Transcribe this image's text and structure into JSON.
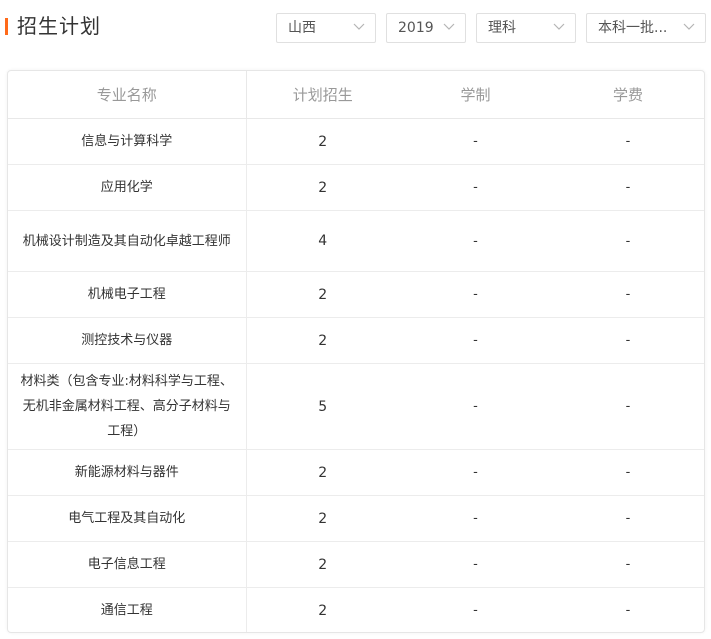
{
  "header": {
    "title": "招生计划"
  },
  "filters": {
    "province": "山西",
    "year": "2019",
    "subject": "理科",
    "batch": "本科一批..."
  },
  "table": {
    "columns": [
      "专业名称",
      "计划招生",
      "学制",
      "学费"
    ],
    "rows": [
      {
        "major": "信息与计算科学",
        "plan": "2",
        "duration": "-",
        "fee": "-"
      },
      {
        "major": "应用化学",
        "plan": "2",
        "duration": "-",
        "fee": "-"
      },
      {
        "major": "机械设计制造及其自动化卓越工程师",
        "plan": "4",
        "duration": "-",
        "fee": "-"
      },
      {
        "major": "机械电子工程",
        "plan": "2",
        "duration": "-",
        "fee": "-"
      },
      {
        "major": "测控技术与仪器",
        "plan": "2",
        "duration": "-",
        "fee": "-"
      },
      {
        "major": "材料类（包含专业:材料科学与工程、无机非金属材料工程、高分子材料与工程）",
        "plan": "5",
        "duration": "-",
        "fee": "-"
      },
      {
        "major": "新能源材料与器件",
        "plan": "2",
        "duration": "-",
        "fee": "-"
      },
      {
        "major": "电气工程及其自动化",
        "plan": "2",
        "duration": "-",
        "fee": "-"
      },
      {
        "major": "电子信息工程",
        "plan": "2",
        "duration": "-",
        "fee": "-"
      },
      {
        "major": "通信工程",
        "plan": "2",
        "duration": "-",
        "fee": "-"
      }
    ]
  },
  "colors": {
    "accent": "#ff6a1a",
    "header_text": "#999999",
    "body_text": "#333333",
    "border": "#e8e8e8"
  },
  "icons": {
    "dropdown": "chevron-down-icon"
  }
}
